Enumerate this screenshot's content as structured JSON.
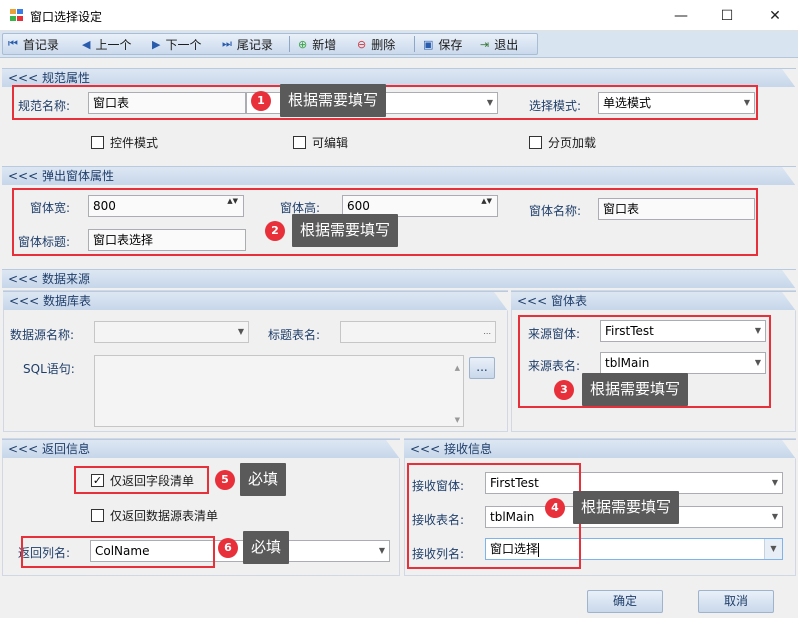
{
  "window": {
    "title": "窗口选择设定",
    "minimize": "—",
    "maximize": "☐",
    "close": "✕"
  },
  "toolbar": {
    "first": "首记录",
    "prev": "上一个",
    "next": "下一个",
    "last": "尾记录",
    "add": "新增",
    "delete": "删除",
    "save": "保存",
    "exit": "退出"
  },
  "spec": {
    "header": "<<< 规范属性",
    "name_label": "规范名称:",
    "name_value": "窗口表",
    "mode_label": "选择模式:",
    "mode_value": "单选模式",
    "control_mode": "控件模式",
    "editable": "可编辑",
    "paging": "分页加载"
  },
  "popup": {
    "header": "<<< 弹出窗体属性",
    "width_label": "窗体宽:",
    "width_value": "800",
    "height_label": "窗体高:",
    "height_value": "600",
    "form_name_label": "窗体名称:",
    "form_name_value": "窗口表",
    "form_title_label": "窗体标题:",
    "form_title_value": "窗口表选择"
  },
  "datasource": {
    "header": "<<< 数据来源",
    "db_header": "<<< 数据库表",
    "ds_name_label": "数据源名称:",
    "title_table_label": "标题表名:",
    "sql_label": "SQL语句:",
    "ellipsis": "...",
    "browse": "...",
    "form_header": "<<< 窗体表",
    "src_form_label": "来源窗体:",
    "src_form_value": "FirstTest",
    "src_table_label": "来源表名:",
    "src_table_value": "tblMain"
  },
  "ret": {
    "header": "<<< 返回信息",
    "only_fields": "仅返回字段清单",
    "only_ds": "仅返回数据源表清单",
    "col_label": "返回列名:",
    "col_value": "ColName"
  },
  "recv": {
    "header": "<<< 接收信息",
    "form_label": "接收窗体:",
    "form_value": "FirstTest",
    "table_label": "接收表名:",
    "table_value": "tblMain",
    "col_label": "接收列名:",
    "col_value": "窗口选择"
  },
  "annotations": {
    "b1": "1",
    "t1": "根据需要填写",
    "b2": "2",
    "t2": "根据需要填写",
    "b3": "3",
    "t3": "根据需要填写",
    "b4": "4",
    "t4": "根据需要填写",
    "b5": "5",
    "t5": "必填",
    "b6": "6",
    "t6": "必填"
  },
  "buttons": {
    "ok": "确定",
    "cancel": "取消"
  },
  "icons": {
    "first": "⏮",
    "prev": "◀",
    "next": "▶",
    "last": "⏭",
    "add": "⊕",
    "delete": "⊖",
    "save": "▣",
    "exit": "⇥",
    "check": "✓",
    "dropdown": "▼",
    "spin": "▲▼"
  },
  "colors": {
    "accent": "#e8303a",
    "tip": "#5a5a5a",
    "header": "#c7d6ea"
  }
}
